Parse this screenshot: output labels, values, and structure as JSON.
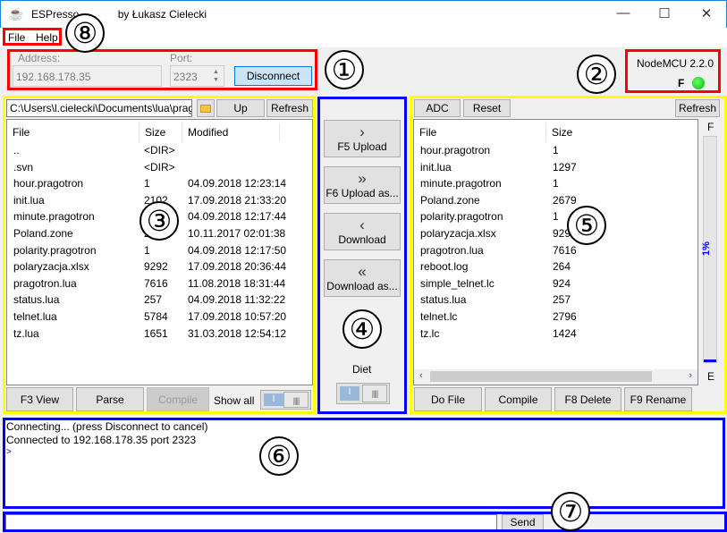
{
  "window": {
    "title_start": "ESPresso",
    "title_end": "by Łukasz Cielecki",
    "minimize": "—",
    "maximize": "☐",
    "close": "✕",
    "icon": "coffee-cup-icon"
  },
  "menu": {
    "items": [
      "File",
      "Help"
    ]
  },
  "connection": {
    "address_label": "Address:",
    "address_value": "192.168.178.35",
    "port_label": "Port:",
    "port_value": "2323",
    "disconnect_label": "Disconnect"
  },
  "device": {
    "firmware": "NodeMCU 2.2.0",
    "flag": "F",
    "status_color": "#22cc22"
  },
  "local": {
    "path": "C:\\Users\\l.cielecki\\Documents\\lua\\pragotron",
    "up_label": "Up",
    "refresh_label": "Refresh",
    "columns": [
      "File",
      "Size",
      "Modified"
    ],
    "rows": [
      [
        "..",
        "<DIR>",
        ""
      ],
      [
        ".svn",
        "<DIR>",
        ""
      ],
      [
        "hour.pragotron",
        "1",
        "04.09.2018 12:23:14"
      ],
      [
        "init.lua",
        "2102",
        "17.09.2018 21:33:20"
      ],
      [
        "minute.pragotron",
        "1",
        "04.09.2018 12:17:44"
      ],
      [
        "Poland.zone",
        "2679",
        "10.11.2017 02:01:38"
      ],
      [
        "polarity.pragotron",
        "1",
        "04.09.2018 12:17:50"
      ],
      [
        "polaryzacja.xlsx",
        "9292",
        "17.09.2018 20:36:44"
      ],
      [
        "pragotron.lua",
        "7616",
        "11.08.2018 18:31:44"
      ],
      [
        "status.lua",
        "257",
        "04.09.2018 11:32:22"
      ],
      [
        "telnet.lua",
        "5784",
        "17.09.2018 10:57:20"
      ],
      [
        "tz.lua",
        "1651",
        "31.03.2018 12:54:12"
      ]
    ],
    "buttons": {
      "view": "F3 View",
      "parse": "Parse",
      "compile": "Compile",
      "show_all": "Show all"
    }
  },
  "transfer": {
    "buttons": [
      {
        "glyph": "›",
        "label": "F5 Upload"
      },
      {
        "glyph": "»",
        "label": "F6 Upload as..."
      },
      {
        "glyph": "‹",
        "label": "Download"
      },
      {
        "glyph": "«",
        "label": "Download as..."
      }
    ],
    "diet_label": "Diet"
  },
  "remote": {
    "adc_label": "ADC",
    "reset_label": "Reset",
    "refresh_label": "Refresh",
    "columns": [
      "File",
      "Size"
    ],
    "rows": [
      [
        "hour.pragotron",
        "1"
      ],
      [
        "init.lua",
        "1297"
      ],
      [
        "minute.pragotron",
        "1"
      ],
      [
        "Poland.zone",
        "2679"
      ],
      [
        "polarity.pragotron",
        "1"
      ],
      [
        "polaryzacja.xlsx",
        "9292"
      ],
      [
        "pragotron.lua",
        "7616"
      ],
      [
        "reboot.log",
        "264"
      ],
      [
        "simple_telnet.lc",
        "924"
      ],
      [
        "status.lua",
        "257"
      ],
      [
        "telnet.lc",
        "2796"
      ],
      [
        "tz.lc",
        "1424"
      ]
    ],
    "flash": {
      "top_label": "F",
      "bottom_label": "E",
      "percent_text": "1%",
      "percent": 1
    },
    "buttons": {
      "dofile": "Do File",
      "compile": "Compile",
      "delete": "F8 Delete",
      "rename": "F9 Rename"
    }
  },
  "console": {
    "lines": [
      "Connecting... (press Disconnect to cancel)",
      "Connected to 192.168.178.35 port 2323"
    ],
    "prompt": ">"
  },
  "command": {
    "value": "",
    "send_label": "Send"
  },
  "annotations": [
    "①",
    "②",
    "③",
    "④",
    "⑤",
    "⑥",
    "⑦",
    "⑧"
  ],
  "colors": {
    "red": "#ff0000",
    "yellow": "#ffff00",
    "blue": "#0000ff"
  }
}
